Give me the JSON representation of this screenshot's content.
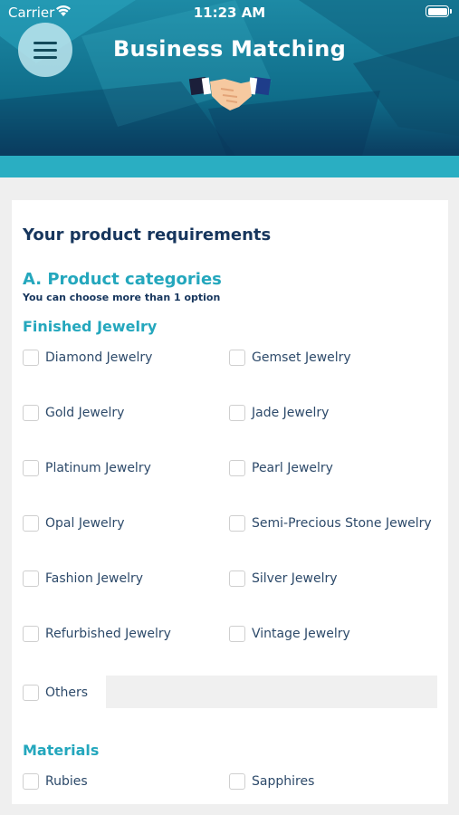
{
  "status_bar": {
    "carrier": "Carrier",
    "time": "11:23 AM"
  },
  "header": {
    "title": "Business Matching"
  },
  "form": {
    "title": "Your product requirements",
    "section_a": {
      "title": "A. Product categories",
      "note": "You can choose more than 1 option",
      "finished_jewelry": {
        "title": "Finished Jewelry",
        "options": [
          "Diamond Jewelry",
          "Gemset Jewelry",
          "Gold Jewelry",
          "Jade Jewelry",
          "Platinum Jewelry",
          "Pearl Jewelry",
          "Opal Jewelry",
          "Semi-Precious Stone Jewelry",
          "Fashion Jewelry",
          "Silver Jewelry",
          "Refurbished Jewelry",
          "Vintage Jewelry"
        ],
        "others_label": "Others",
        "others_value": ""
      },
      "materials": {
        "title": "Materials",
        "options": [
          "Rubies",
          "Sapphires"
        ]
      }
    }
  }
}
